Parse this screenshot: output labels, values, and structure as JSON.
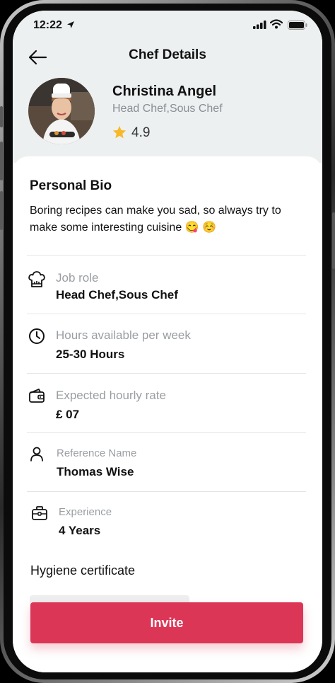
{
  "status_bar": {
    "time": "12:22",
    "icons": [
      "location-arrow-icon",
      "signal-icon",
      "wifi-icon",
      "battery-icon"
    ]
  },
  "header": {
    "title": "Chef Details",
    "back_icon": "arrow-left-icon"
  },
  "profile": {
    "name": "Christina Angel",
    "role": "Head Chef,Sous Chef",
    "rating": "4.9",
    "rating_icon": "star-icon",
    "rating_color": "#f7b928"
  },
  "bio": {
    "heading": "Personal Bio",
    "text": "Boring recipes can make you sad, so always try to make some interesting cuisine 😋 ☺️"
  },
  "details": [
    {
      "icon": "chef-hat-icon",
      "label": "Job role",
      "value": "Head Chef,Sous Chef"
    },
    {
      "icon": "clock-icon",
      "label": "Hours available per week",
      "value": "25-30 Hours"
    },
    {
      "icon": "wallet-icon",
      "label": "Expected hourly rate",
      "value": "£ 07"
    },
    {
      "icon": "person-icon",
      "label": "Reference Name",
      "value": "Thomas Wise"
    },
    {
      "icon": "briefcase-icon",
      "label": "Experience",
      "value": "4 Years"
    }
  ],
  "hygiene": {
    "label": "Hygiene certificate"
  },
  "actions": {
    "invite_label": "Invite",
    "accent": "#dc3657"
  }
}
